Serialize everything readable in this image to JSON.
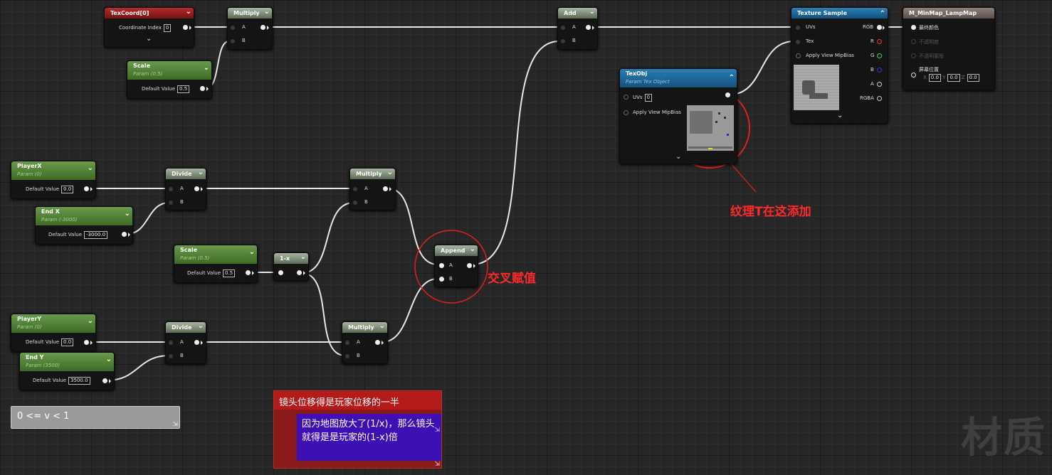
{
  "nodes": {
    "texcoord": {
      "title": "TexCoord[0]",
      "label": "Coordinate Index",
      "value": "0"
    },
    "multiply_top": {
      "title": "Multiply",
      "a": "A",
      "b": "B"
    },
    "scale_top": {
      "title": "Scale",
      "subtitle": "Param (0.5)",
      "label": "Default Value",
      "value": "0.5"
    },
    "add": {
      "title": "Add",
      "a": "A",
      "b": "B"
    },
    "texture_sample": {
      "title": "Texture Sample",
      "in_uvs": "UVs",
      "in_tex": "Tex",
      "in_mip": "Apply View MipBias",
      "out_rgb": "RGB",
      "out_r": "R",
      "out_g": "G",
      "out_b": "B",
      "out_a": "A",
      "out_rgba": "RGBA"
    },
    "material": {
      "title": "M_MinMap_LampMap",
      "p1": "最终颜色",
      "p2": "不透明度",
      "p3": "不透明蒙版",
      "p4": "屏幕位置",
      "x_label": "X",
      "x_val": "0.0",
      "y_label": "Y",
      "y_val": "0.0",
      "z_label": "Z",
      "z_val": "0.0"
    },
    "texobj": {
      "title": "TexObj",
      "subtitle": "Param Tex Object",
      "uvs": "UVs",
      "uvs_val": "0",
      "mip": "Apply View MipBias"
    },
    "playerx": {
      "title": "PlayerX",
      "subtitle": "Param (0)",
      "label": "Default Value",
      "value": "0.0"
    },
    "endx": {
      "title": "End X",
      "subtitle": "Param (-3000)",
      "label": "Default Value",
      "value": "-3000.0"
    },
    "divide1": {
      "title": "Divide",
      "a": "A",
      "b": "B"
    },
    "multiply_mid": {
      "title": "Multiply",
      "a": "A",
      "b": "B"
    },
    "scale_mid": {
      "title": "Scale",
      "subtitle": "Param (0.5)",
      "label": "Default Value",
      "value": "0.5"
    },
    "oneminus": {
      "title": "1-x"
    },
    "append": {
      "title": "Append",
      "a": "A",
      "b": "B"
    },
    "playery": {
      "title": "PlayerY",
      "subtitle": "Param (0)",
      "label": "Default Value",
      "value": "0.0"
    },
    "endy": {
      "title": "End Y",
      "subtitle": "Param (3500)",
      "label": "Default Value",
      "value": "3500.0"
    },
    "divide2": {
      "title": "Divide",
      "a": "A",
      "b": "B"
    },
    "multiply_bot": {
      "title": "Multiply",
      "a": "A",
      "b": "B"
    }
  },
  "annotations": {
    "texture_note": "纹理T在这添加",
    "append_note": "交叉赋值"
  },
  "comments": {
    "range": "0 <= v < 1",
    "camera_title": "镜头位移得是玩家位移的一半",
    "camera_body": "因为地图放大了(1/x)，那么镜头就得是是玩家的(1-x)倍"
  },
  "watermark": "材质",
  "colors": {
    "param_header": "#5a8a3c",
    "math_header": "#7f8c7a",
    "texcoord_header": "#9e1f1f",
    "texture_header": "#1f6fa3",
    "annotation": "#ff2a2a",
    "comment_red": "#b71c1c",
    "comment_purple": "#3d10b5"
  }
}
